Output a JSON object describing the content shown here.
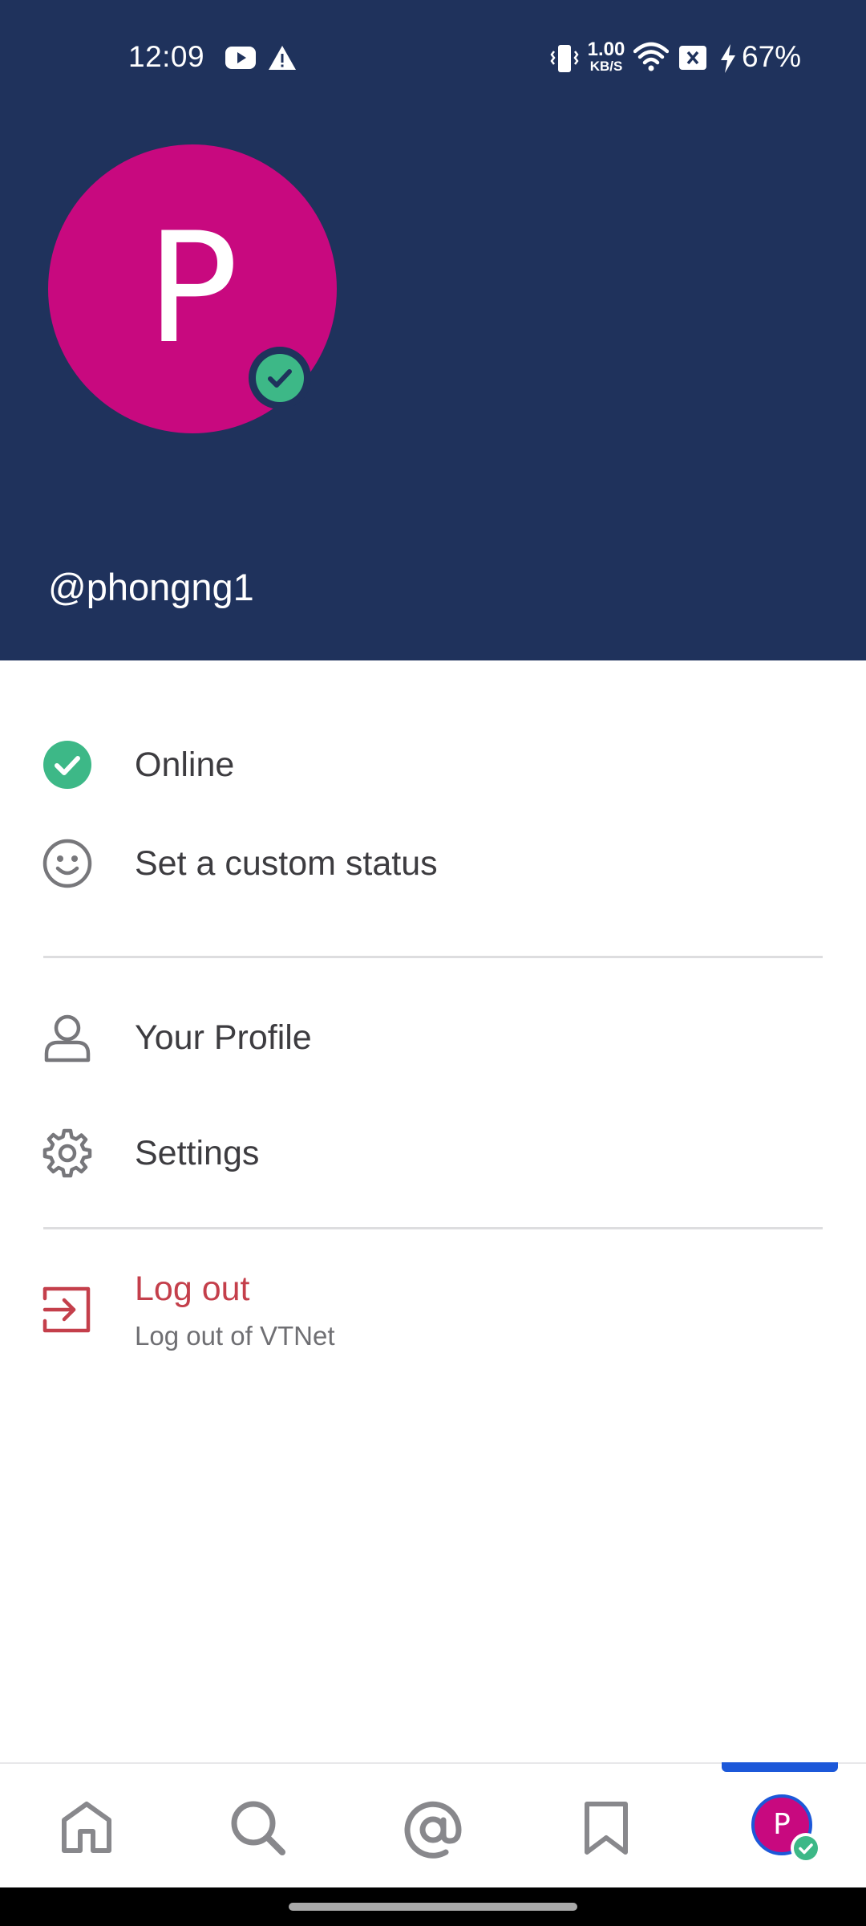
{
  "status_bar": {
    "time": "12:09",
    "net_speed_value": "1.00",
    "net_speed_unit": "KB/S",
    "battery": "67%",
    "icons": [
      "youtube-icon",
      "warning-icon",
      "vibrate-icon",
      "wifi-icon",
      "sim-off-icon",
      "charging-icon"
    ]
  },
  "profile": {
    "avatar_letter": "P",
    "username": "@phongng1",
    "avatar_color": "#c8097f",
    "status_color": "#3db887"
  },
  "menu": {
    "online_label": "Online",
    "custom_status_label": "Set a custom status",
    "profile_label": "Your Profile",
    "settings_label": "Settings",
    "logout_label": "Log out",
    "logout_sub": "Log out of VTNet"
  },
  "bottom_nav": {
    "items": [
      "home-icon",
      "search-icon",
      "mentions-icon",
      "saved-icon",
      "account-avatar"
    ],
    "active": "account-avatar",
    "avatar_letter": "P"
  },
  "colors": {
    "header_bg": "#1f325c",
    "accent": "#1c58d9",
    "danger": "#c43f4b",
    "online": "#3db887"
  }
}
